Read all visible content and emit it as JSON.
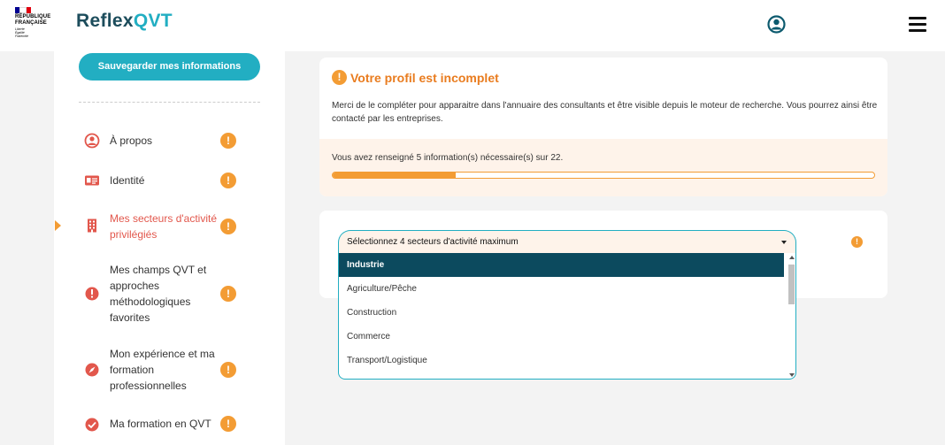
{
  "header": {
    "gov_logo": {
      "line1": "RÉPUBLIQUE",
      "line2": "FRANÇAISE",
      "motto1": "Liberté",
      "motto2": "Égalité",
      "motto3": "Fraternité",
      "flag_colors": [
        "#000091",
        "#ffffff",
        "#e1000f"
      ]
    },
    "brand_prefix": "Reflex",
    "brand_suffix": "QVT",
    "user_icon": "user-circle-icon",
    "menu_icon": "hamburger-icon"
  },
  "sidebar": {
    "save_label": "Sauvegarder mes informations",
    "items": [
      {
        "label": "À propos",
        "icon": "user-circle-icon",
        "warning": "!"
      },
      {
        "label": "Identité",
        "icon": "id-card-icon",
        "warning": "!"
      },
      {
        "label": "Mes secteurs d'activité privilégiés",
        "icon": "building-icon",
        "warning": "!",
        "active": true
      },
      {
        "label": "Mes champs QVT et approches méthodologiques favorites",
        "icon": "info-icon",
        "warning": "!"
      },
      {
        "label": "Mon expérience et ma formation professionnelles",
        "icon": "compass-icon",
        "warning": "!"
      },
      {
        "label": "Ma formation en QVT",
        "icon": "check-circle-icon",
        "warning": "!"
      }
    ]
  },
  "profile_card": {
    "title": "Votre profil est incomplet",
    "description": "Merci de le compléter pour apparaitre dans l'annuaire des consultants et être visible depuis le moteur de recherche. Vous pourrez ainsi être contacté par les entreprises.",
    "progress_text": "Vous avez renseigné 5 information(s) nécessaire(s) sur 22.",
    "progress_filled": 5,
    "progress_total": 22
  },
  "sectors": {
    "placeholder": "Sélectionnez 4 secteurs d'activité maximum",
    "options": [
      "Industrie",
      "Agriculture/Pêche",
      "Construction",
      "Commerce",
      "Transport/Logistique"
    ],
    "highlighted": "Industrie"
  },
  "colors": {
    "brand_dark": "#1d4d5c",
    "accent_teal": "#22aec2",
    "warning_orange": "#f39c34",
    "active_red": "#e2574c",
    "highlight_navy": "#0c4a5e"
  }
}
